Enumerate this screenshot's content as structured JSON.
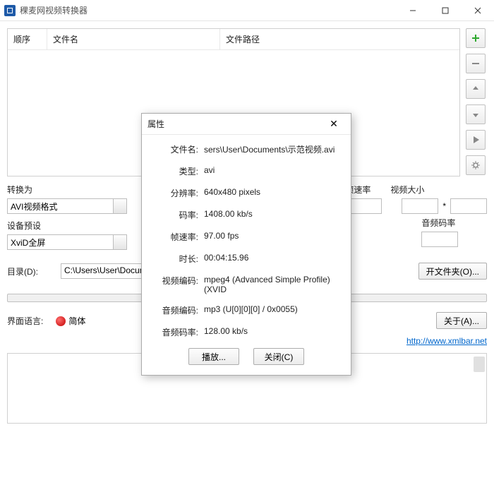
{
  "window": {
    "title": "稞麦网视频转换器"
  },
  "filelist": {
    "cols": {
      "order": "顺序",
      "name": "文件名",
      "path": "文件路径"
    }
  },
  "labels": {
    "convert_to": "转换为",
    "device_preset": "设备预设",
    "directory": "目录(D):",
    "open_folder": "开文件夹(O)...",
    "ui_language": "界面语言:",
    "lang_zh": "简体",
    "about": "关于(A)...",
    "frame_rate": "帧速率",
    "video_size": "视频大小",
    "audio_bitrate": "音频码率",
    "times": "*"
  },
  "selects": {
    "format": "AVI视频格式",
    "preset": "XviD全屏"
  },
  "inputs": {
    "directory": "C:\\Users\\User\\Docum"
  },
  "link": {
    "url_text": "http://www.xmlbar.net"
  },
  "dialog": {
    "title": "属性",
    "play": "播放...",
    "close": "关闭(C)",
    "rows": {
      "filename_k": "文件名:",
      "filename_v": "sers\\User\\Documents\\示范视频.avi",
      "type_k": "类型:",
      "type_v": "avi",
      "res_k": "分辨率:",
      "res_v": "640x480 pixels",
      "bitrate_k": "码率:",
      "bitrate_v": "1408.00 kb/s",
      "fps_k": "帧速率:",
      "fps_v": "97.00 fps",
      "duration_k": "时长:",
      "duration_v": "00:04:15.96",
      "venc_k": "视频编码:",
      "venc_v": "mpeg4 (Advanced Simple Profile) (XVID",
      "aenc_k": "音频编码:",
      "aenc_v": "mp3 (U[0][0][0] / 0x0055)",
      "abitrate_k": "音频码率:",
      "abitrate_v": "128.00 kb/s"
    }
  }
}
